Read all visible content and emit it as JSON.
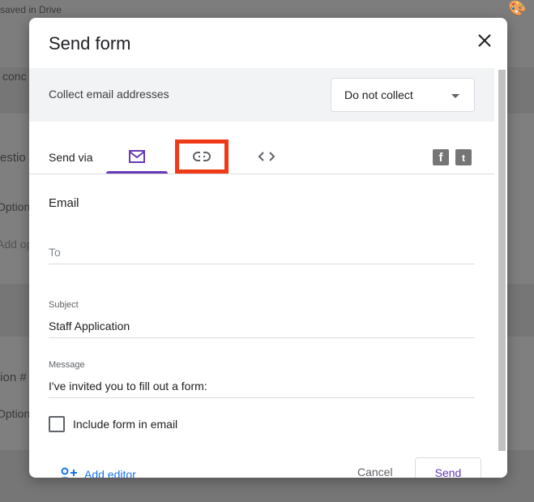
{
  "background": {
    "saved": "saved in Drive",
    "conc": "conc",
    "question": "estio",
    "option1": "Option",
    "add_option": "Add op",
    "question2": "tion #",
    "option2": "Option"
  },
  "dialog": {
    "title": "Send form",
    "collect_label": "Collect email addresses",
    "collect_value": "Do not collect",
    "send_via": "Send via",
    "tabs": [
      {
        "icon": "email-icon",
        "active": true
      },
      {
        "icon": "link-icon",
        "active": false,
        "highlighted": true
      },
      {
        "icon": "embed-code-icon",
        "active": false
      }
    ],
    "social": [
      "facebook-icon",
      "twitter-icon"
    ],
    "section_title": "Email",
    "to_placeholder": "To",
    "subject_label": "Subject",
    "subject_value": "Staff Application",
    "message_label": "Message",
    "message_value": "I've invited you to fill out a form:",
    "include_label": "Include form in email",
    "include_checked": false,
    "add_editor": "Add editor",
    "cancel": "Cancel",
    "send": "Send"
  },
  "colors": {
    "accent": "#673ab7",
    "highlight": "#f03a17",
    "link": "#1a73e8"
  }
}
